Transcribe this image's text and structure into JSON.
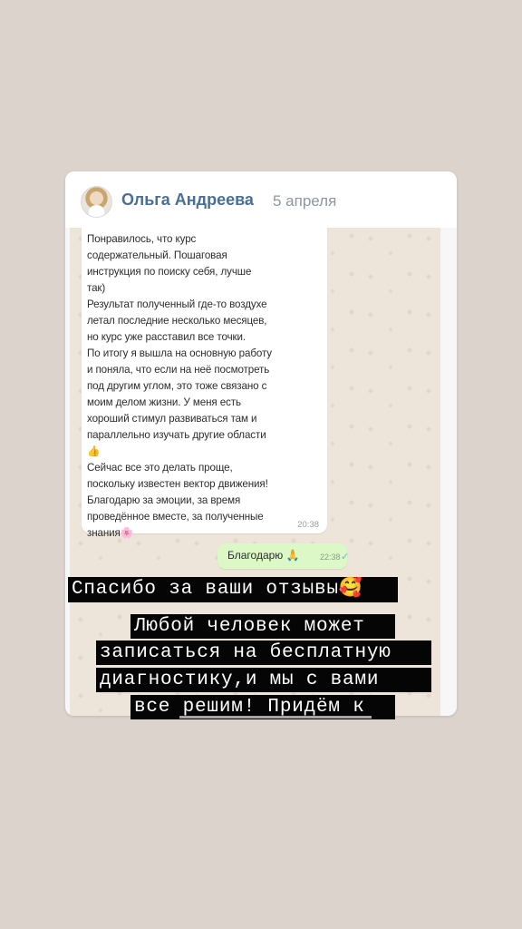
{
  "post": {
    "author": "Ольга Андреева",
    "date": "5 апреля"
  },
  "chat": {
    "incoming": {
      "text": "Понравилось, что курс\nсодержательный. Пошаговая\nинструкция по поиску себя, лучше\nтак)\nРезультат полученный где-то воздухе\nлетал последние несколько месяцев,\nно курс уже расставил все точки.\nПо итогу я вышла на основную работу\nи поняла, что если на неё посмотреть\nпод другим углом, это тоже связано с\nмоим делом жизни.  У меня есть\nхороший стимул развиваться там и\nпараллельно изучать другие области\n👍\nСейчас все это делать проще,\nпоскольку известен вектор движения!\nБлагодарю за эмоции, за время\nпроведённое вместе, за полученные\nзнания🌸",
      "time": "20:38"
    },
    "outgoing": {
      "text": "Благодарю 🙏",
      "time": "22:38",
      "status_icon": "double-check-icon"
    }
  },
  "caption": {
    "line1": "Спасибо за ваши отзывы🥰",
    "line2": "Любой человек может",
    "line3": "записаться на бесплатную",
    "line4": "диагностику,и мы с вами",
    "line5": "все решим! Придём к"
  },
  "colors": {
    "background": "#dcd3cd",
    "author": "#4a6f96",
    "chat_bg": "#ede4da",
    "outgoing_bubble": "#dcf8c6",
    "caption_bg": "#050505"
  }
}
